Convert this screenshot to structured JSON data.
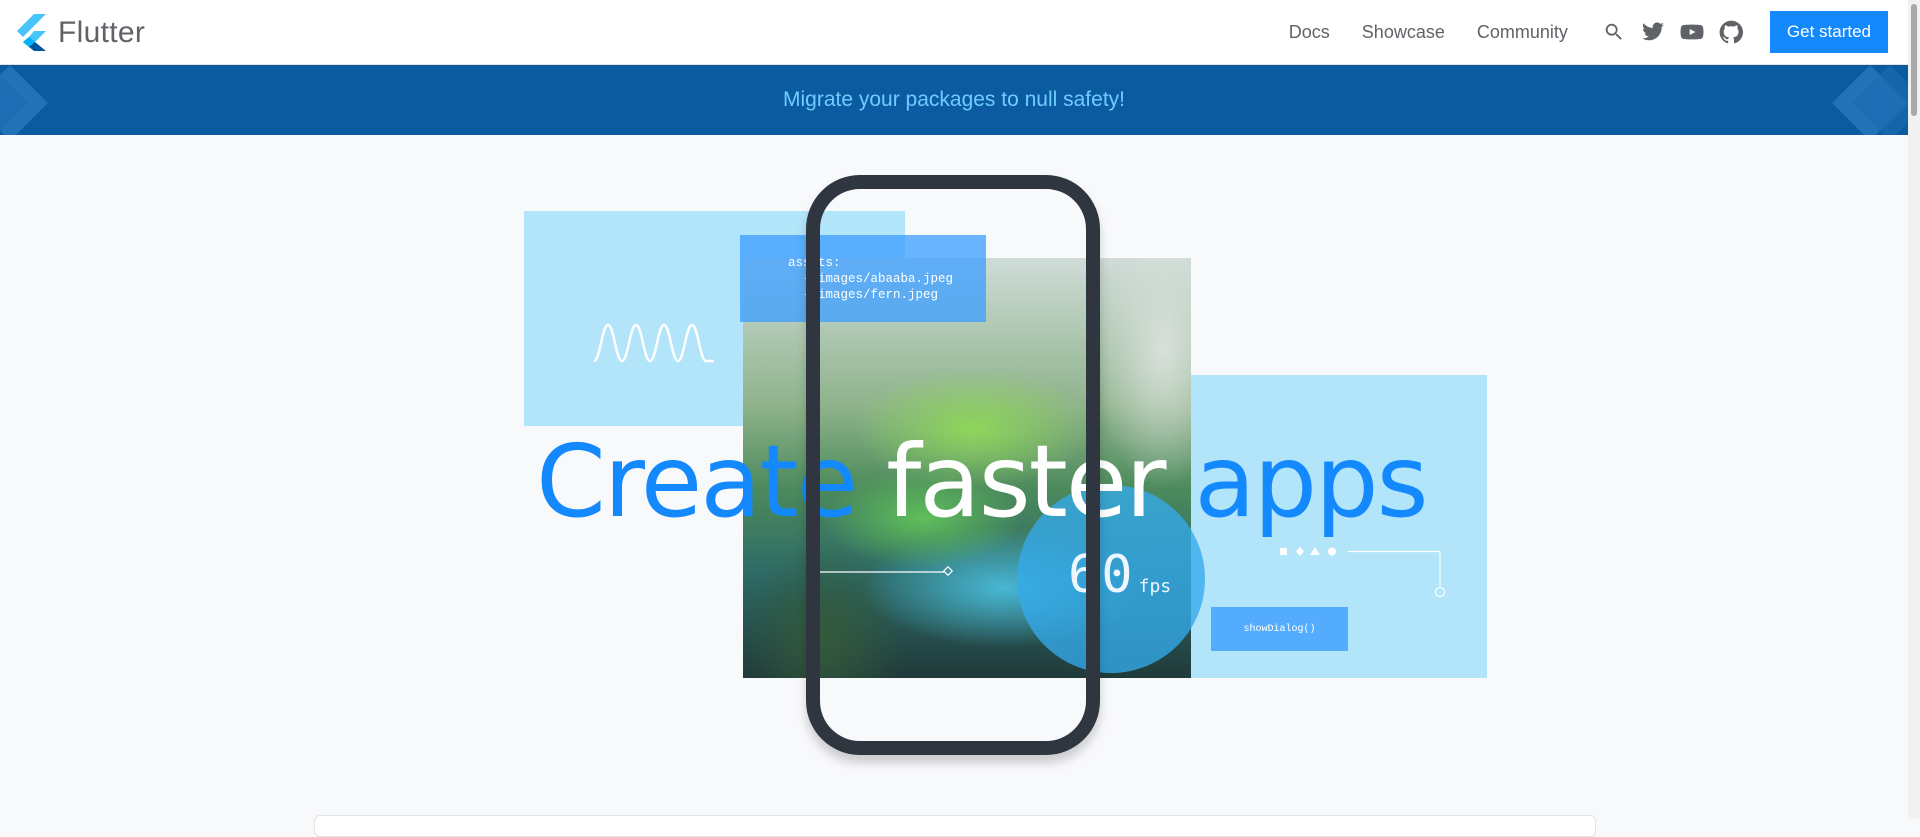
{
  "header": {
    "logo_text": "Flutter",
    "nav": [
      {
        "label": "Docs"
      },
      {
        "label": "Showcase"
      },
      {
        "label": "Community"
      }
    ],
    "icons": [
      "search-icon",
      "twitter-icon",
      "youtube-icon",
      "github-icon"
    ],
    "cta_label": "Get started"
  },
  "banner": {
    "text": "Migrate your packages to null safety!"
  },
  "hero": {
    "headline": [
      "Create",
      "faster",
      "apps"
    ],
    "code_snippet": "assets:\n  - images/abaaba.jpeg\n  - images/fern.jpeg",
    "dialog_label": "showDialog()",
    "fps_value": "60",
    "fps_unit": "fps"
  },
  "colors": {
    "brand_blue": "#1389fd",
    "banner_bg": "#0b5ba1",
    "banner_text": "#6ecdff",
    "panel_light": "#b3e5fa",
    "panel_mid": "#55b0ff"
  }
}
